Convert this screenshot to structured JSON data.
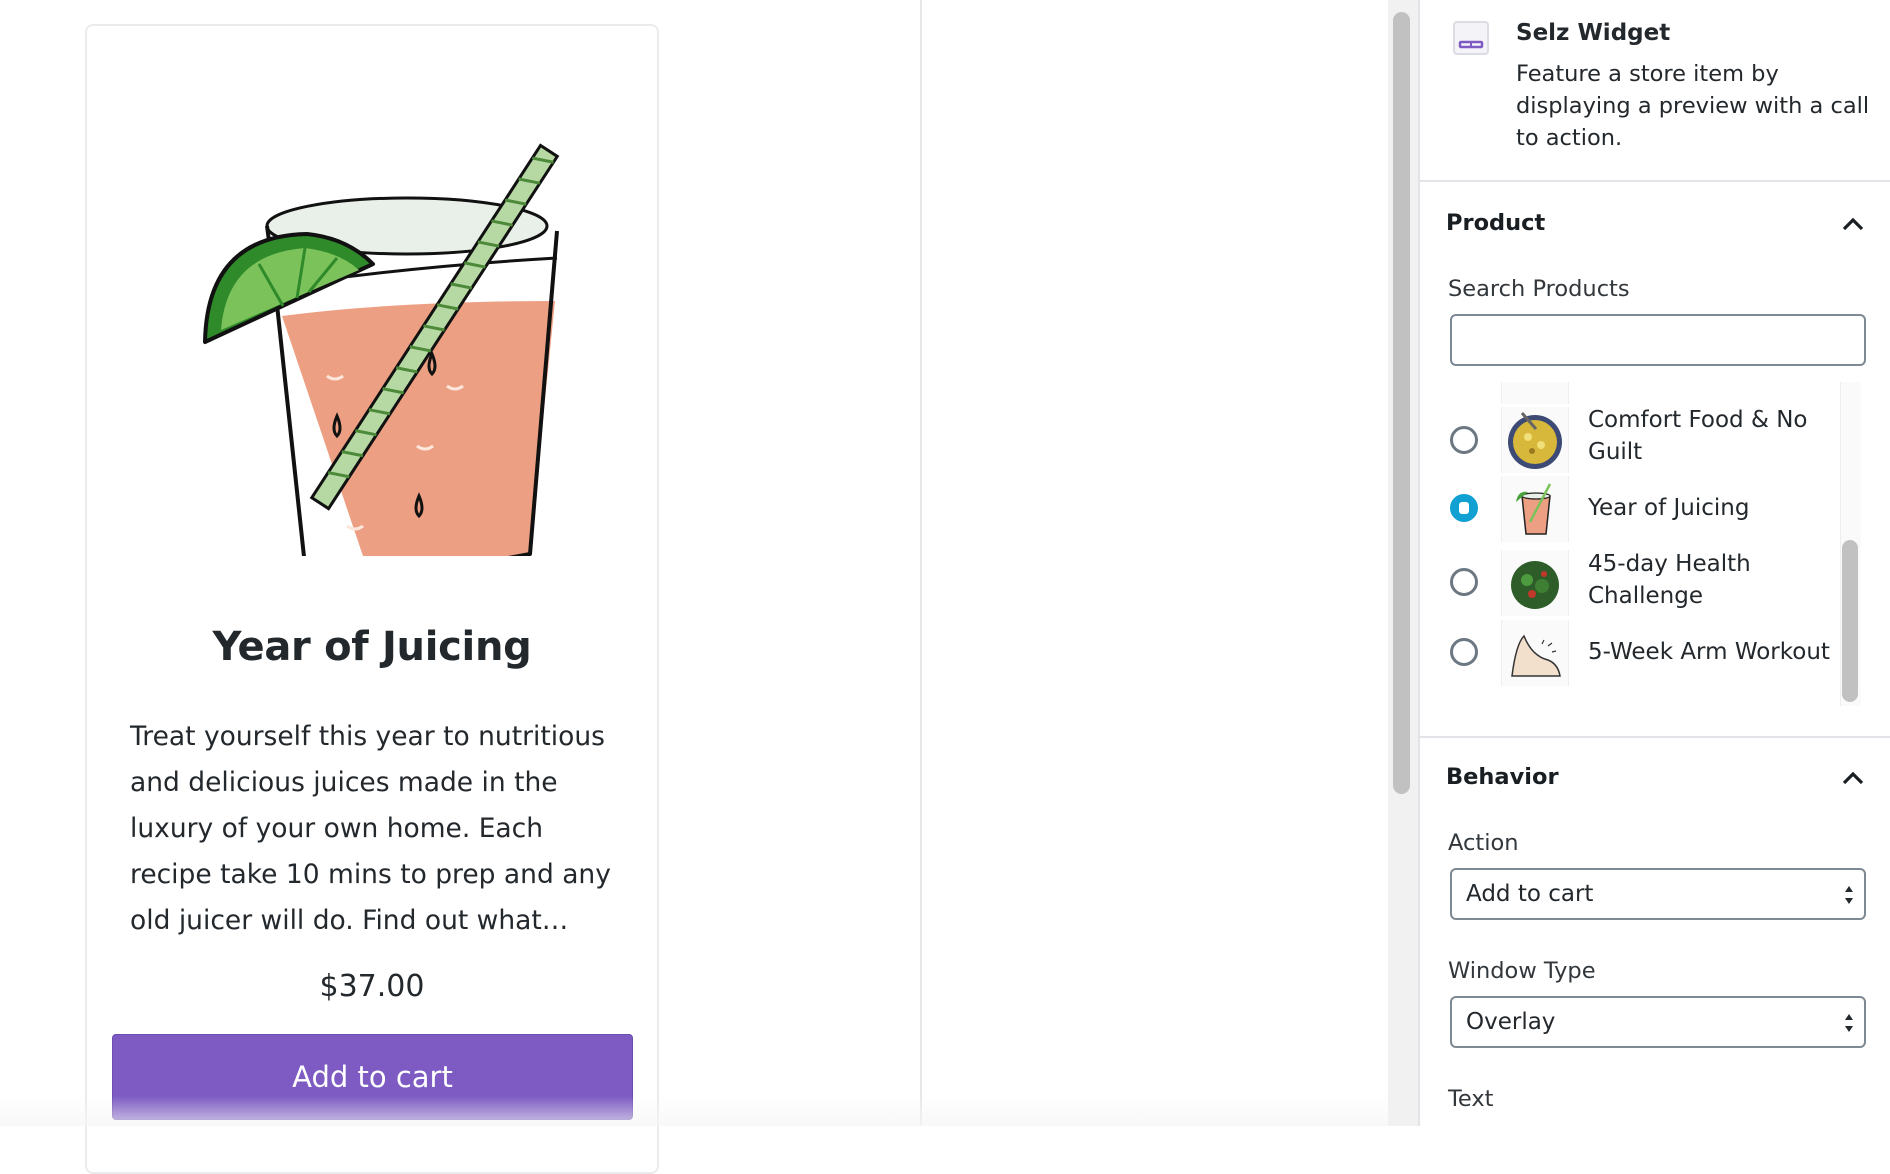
{
  "product_card": {
    "title": "Year of Juicing",
    "description": "Treat yourself this year to nutritious and delicious juices made in the luxury of your own home. Each recipe take 10 mins to prep and any old juicer will do. Find out what…",
    "price": "$37.00",
    "button_label": "Add to cart",
    "illustration": "juice-glass-with-lime-and-straw",
    "button_color": "#7d5bc3"
  },
  "sidebar": {
    "block": {
      "title": "Selz Widget",
      "description": "Feature a store item by displaying a preview with a call to action.",
      "icon": "widget-icon"
    },
    "product_panel": {
      "title": "Product",
      "expanded": true,
      "search_label": "Search Products",
      "search_value": "",
      "items": [
        {
          "label": "Comfort Food & No Guilt",
          "selected": false,
          "thumb": "bowl-thumbnail"
        },
        {
          "label": "Year of Juicing",
          "selected": true,
          "thumb": "juice-thumbnail"
        },
        {
          "label": "45-day Health Challenge",
          "selected": false,
          "thumb": "salad-thumbnail"
        },
        {
          "label": "5-Week Arm Workout",
          "selected": false,
          "thumb": "arm-thumbnail"
        }
      ]
    },
    "behavior_panel": {
      "title": "Behavior",
      "expanded": true,
      "action_label": "Action",
      "action_value": "Add to cart",
      "window_type_label": "Window Type",
      "window_type_value": "Overlay",
      "text_label": "Text"
    }
  },
  "colors": {
    "accent": "#7d5bc3",
    "radio_selected": "#11a0d2"
  }
}
